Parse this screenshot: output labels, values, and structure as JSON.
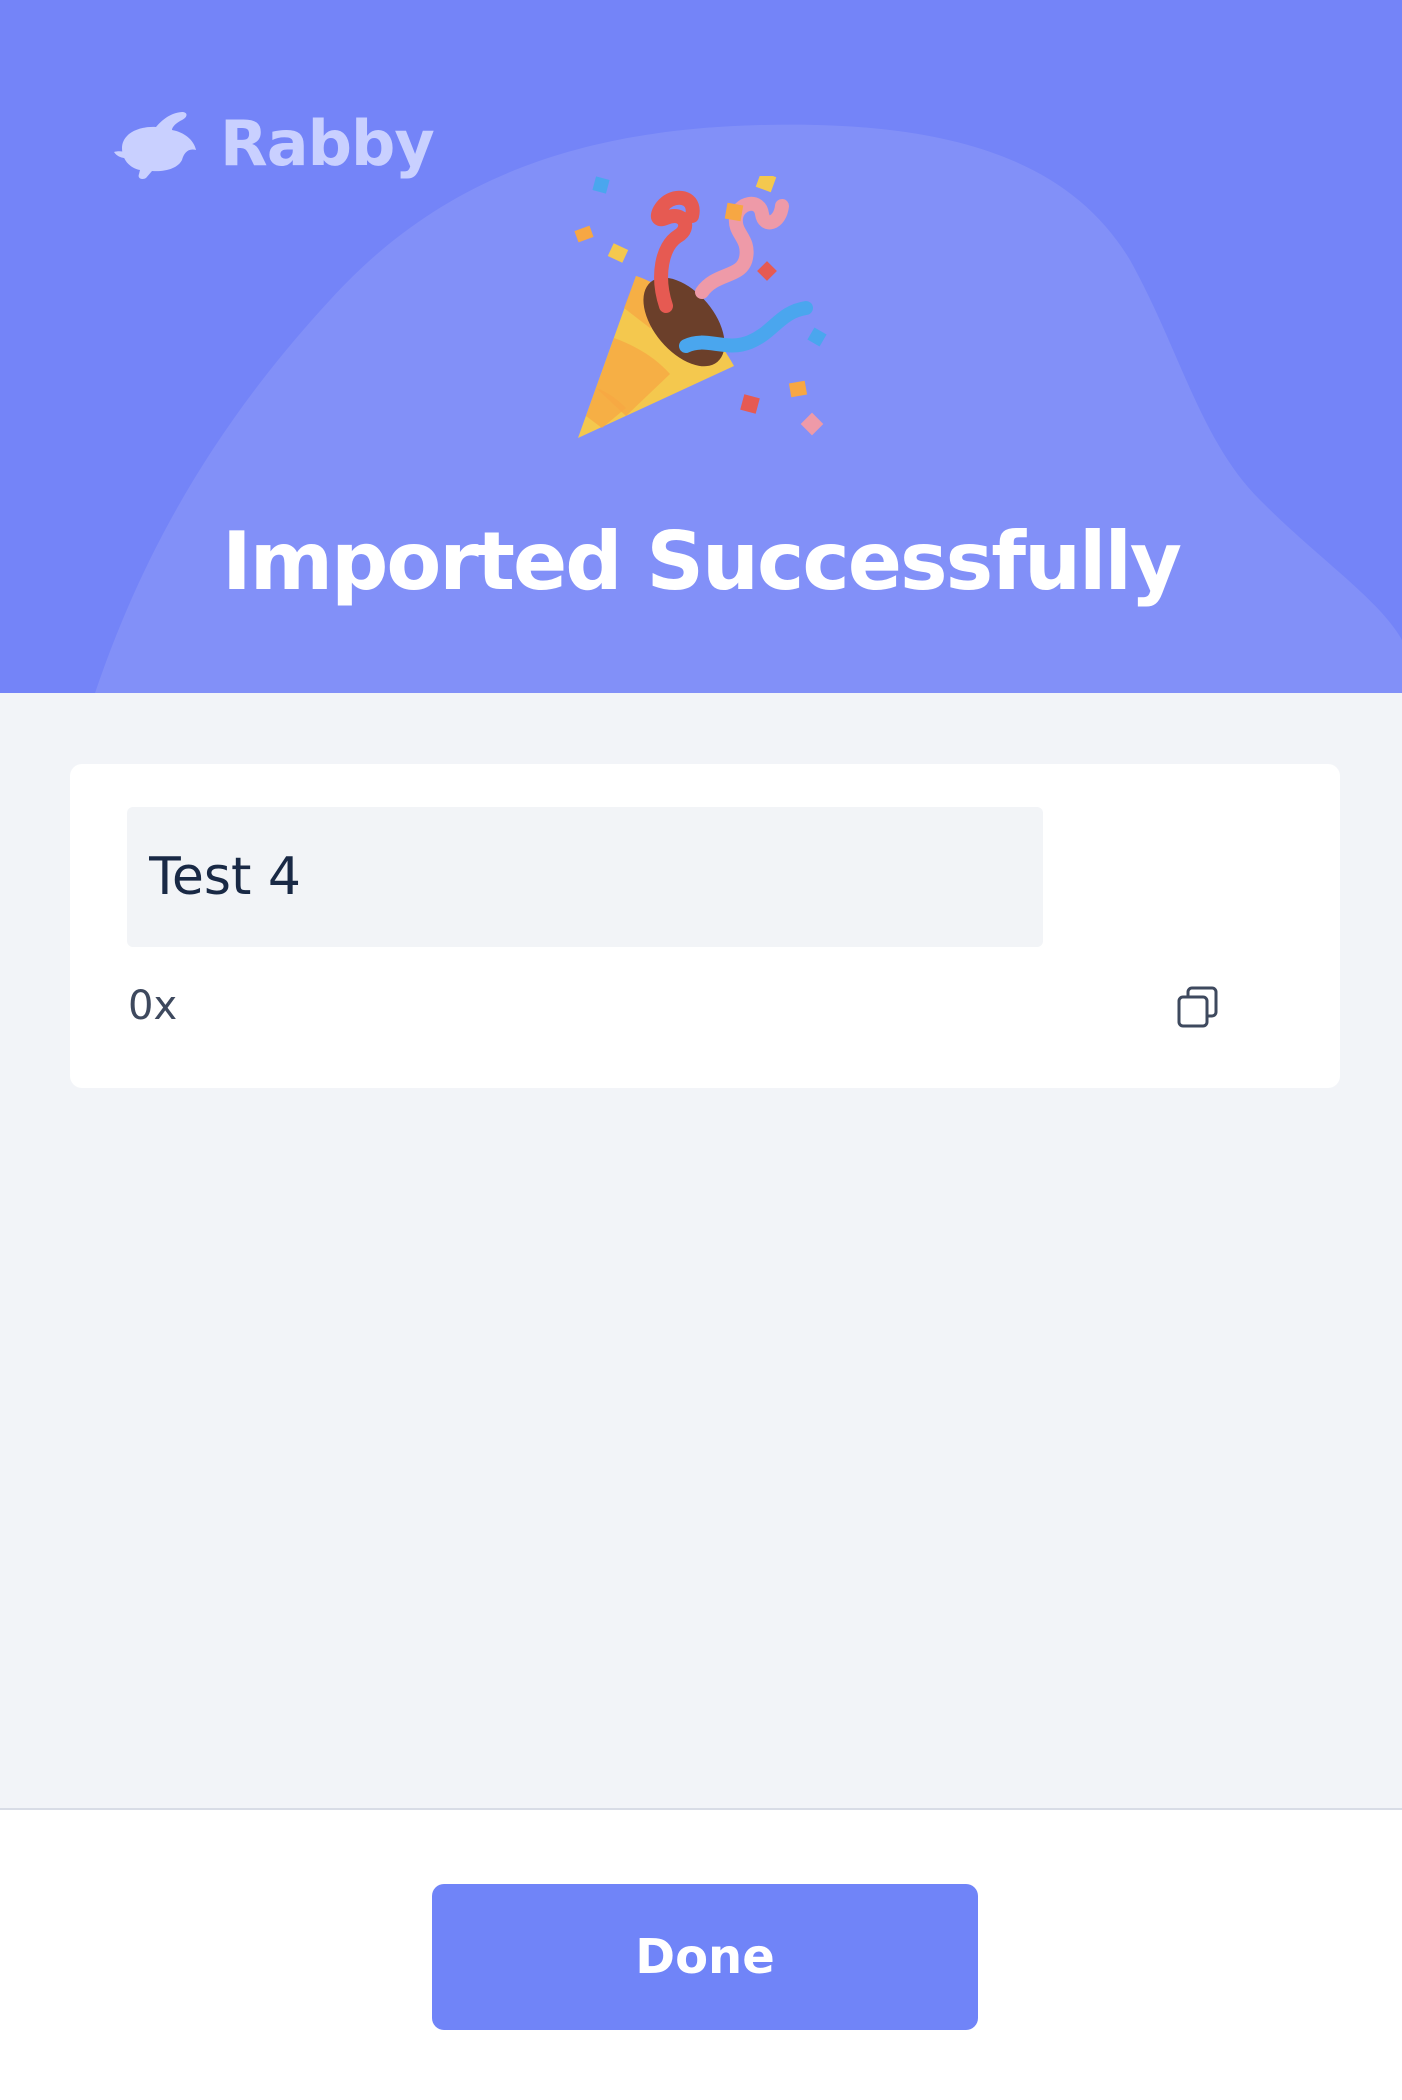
{
  "header": {
    "brand_name": "Rabby",
    "title": "Imported Successfully",
    "illustration": "party-popper-icon"
  },
  "account": {
    "name_value": "Test 4",
    "address_prefix": "0x",
    "copy_icon": "copy-icon"
  },
  "footer": {
    "done_label": "Done"
  },
  "colors": {
    "accent": "#7084f8",
    "hero_background": "#7484f8",
    "page_background": "#f2f4f8",
    "text_primary": "#192945",
    "text_secondary": "#3e495e"
  }
}
